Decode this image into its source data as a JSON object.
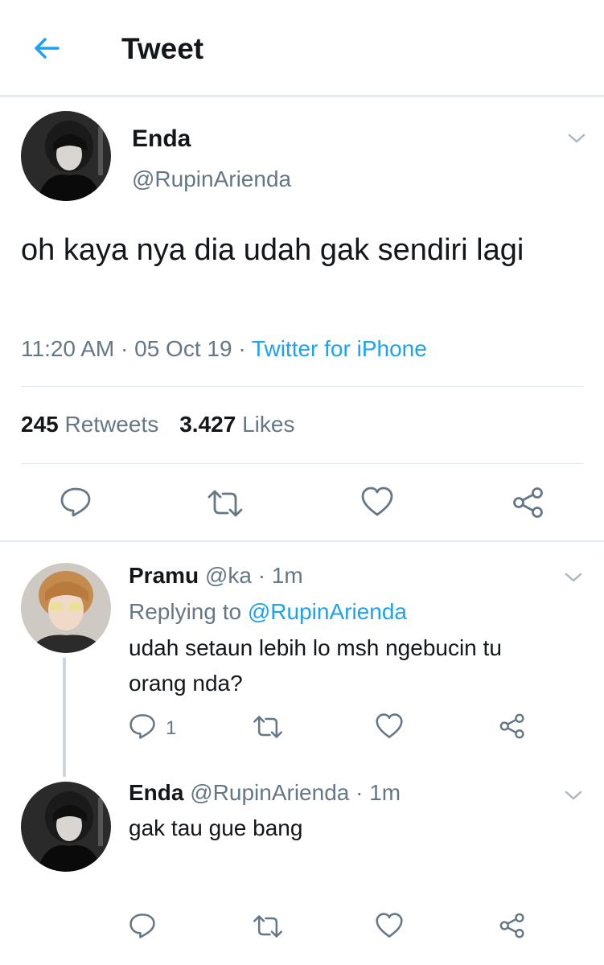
{
  "header": {
    "title": "Tweet"
  },
  "main_tweet": {
    "name": "Enda",
    "handle": "@RupinArienda",
    "text": "oh kaya nya dia udah gak sendiri lagi",
    "time": "11:20 AM",
    "date": "05 Oct 19",
    "source": "Twitter for iPhone",
    "retweets_count": "245",
    "retweets_label": "Retweets",
    "likes_count": "3.427",
    "likes_label": "Likes"
  },
  "replies": [
    {
      "name": "Pramu",
      "handle": "@ka",
      "time": "1m",
      "replying_prefix": "Replying to",
      "replying_handle": "@RupinArienda",
      "text_line1": "udah setaun lebih lo msh ngebucin tu",
      "text_line2": "orang nda?",
      "reply_count": "1"
    },
    {
      "name": "Enda",
      "handle": "@RupinArienda",
      "time": "1m",
      "text": "gak tau gue bang"
    }
  ],
  "icons": {
    "back": "arrow-left-icon",
    "reply": "speech-bubble-icon",
    "retweet": "retweet-icon",
    "like": "heart-icon",
    "share": "share-icon",
    "more": "chevron-down-icon"
  },
  "colors": {
    "accent": "#1da1f2",
    "muted": "#657786",
    "text": "#14171a",
    "divider": "#e1e8ed"
  }
}
